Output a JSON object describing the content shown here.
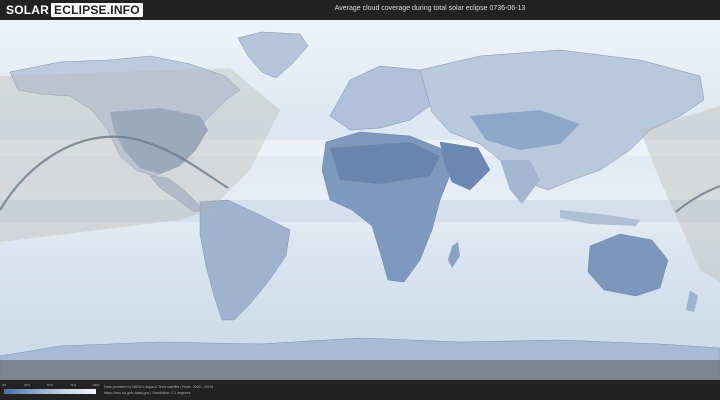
{
  "header": {
    "logo_part1": "SOLAR",
    "logo_part2": "ECLIPSE.INFO",
    "title": "Average cloud coverage during total solar eclipse 0736-06-13"
  },
  "legend": {
    "ticks": [
      "0%",
      "25%",
      "50%",
      "75%",
      "100%"
    ],
    "colors": [
      "#4a6fa0",
      "#8aa6c8",
      "#c7d6e8",
      "#f2f5f9"
    ]
  },
  "credits": {
    "line1": "Data provided by NASA's Aqua & Terra satellite (Years: 2000 - 2019)",
    "line2": "https://neo.sci.gsfc.nasa.gov | Resolution: 0.1 degrees"
  },
  "colors": {
    "ocean": "#e3ebf4",
    "land": "#8ea5c6",
    "cloudy_land": "#d6e2ee",
    "night_shadow": "#b8b4ac",
    "eclipse_path": "#6b7a88"
  }
}
